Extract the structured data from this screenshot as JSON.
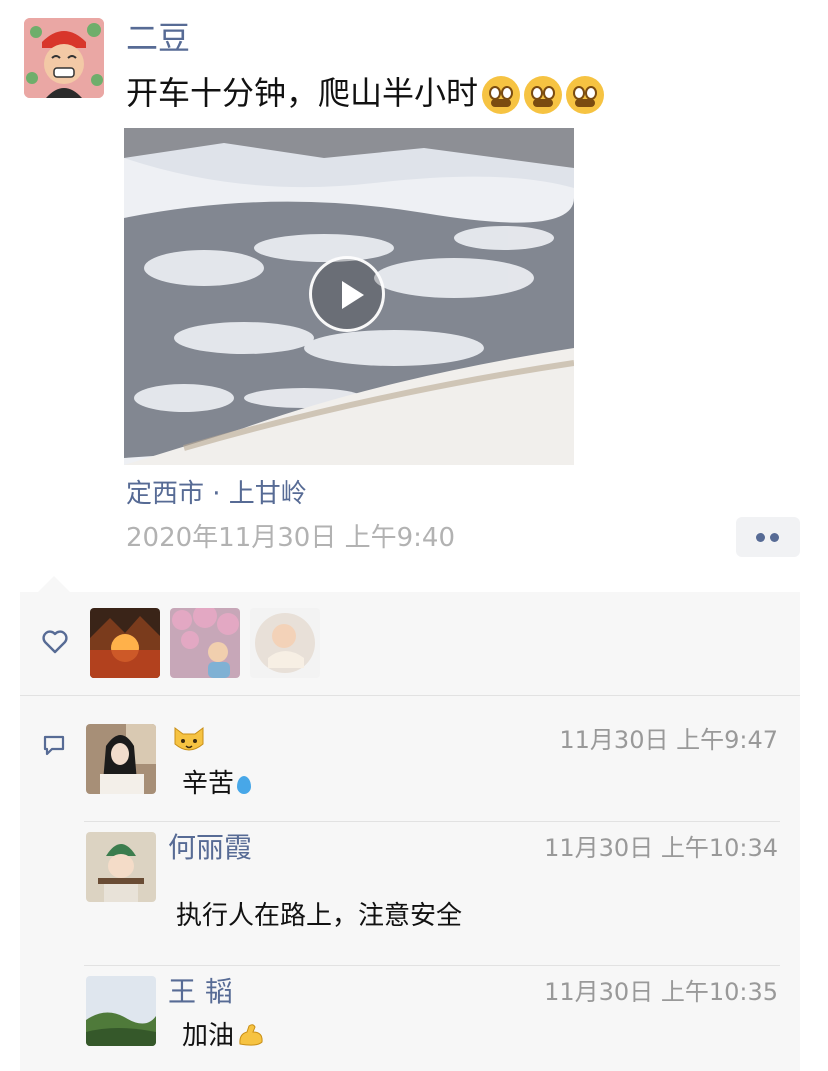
{
  "post": {
    "author": "二豆",
    "text": "开车十分钟，爬山半小时",
    "emoji": [
      "grimacing-face",
      "grimacing-face",
      "grimacing-face"
    ],
    "location": "定西市 · 上甘岭",
    "timestamp": "2020年11月30日 上午9:40"
  },
  "likes": {
    "icon": "heart-icon",
    "count_avatars": 3
  },
  "comments": [
    {
      "name": "",
      "name_emoji": "cat-face-icon",
      "time": "11月30日 上午9:47",
      "text": "辛苦",
      "text_emoji": "sweat-droplets-icon"
    },
    {
      "name": "何丽霞",
      "time": "11月30日 上午10:34",
      "text": "执行人在路上，注意安全"
    },
    {
      "name": "王 韬",
      "time": "11月30日 上午10:35",
      "text": "加油",
      "text_emoji": "flexed-biceps-icon"
    }
  ],
  "colors": {
    "link": "#576b95",
    "time": "#b2b2b2",
    "panel_bg": "#f7f7f7"
  }
}
